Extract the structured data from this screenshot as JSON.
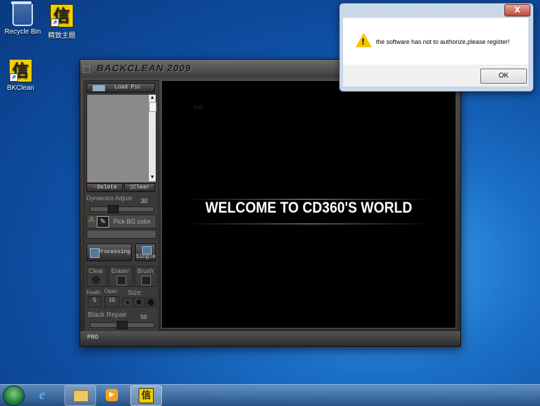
{
  "desktop": {
    "icons": [
      {
        "label": "Recycle Bin"
      },
      {
        "label": "精致主题"
      },
      {
        "label": "BKClean"
      }
    ]
  },
  "app": {
    "title": "BACKCLEAN 2009",
    "load_pic_label": "Load Pic",
    "delete_label": "Delete",
    "clear_label": "Clear",
    "dynamics_label": "Dynamics Adjust",
    "dynamics_value": "30",
    "pick_bg_label": "Pick BG color",
    "processing_label": "Processing",
    "single_label": "Single",
    "tool_clear_label": "Clear",
    "tool_eraser_label": "Eraser",
    "tool_brush_label": "Brush",
    "feath_label": "Feath",
    "feath_value": "5",
    "opac_label": "Opac",
    "opac_value": "10",
    "size_label": "Size",
    "black_repair_label": "Black Repair",
    "black_repair_value": "50",
    "canvas_mark": "CH3",
    "welcome_text": "WELCOME TO CD360'S WORLD",
    "status_text": "PRO"
  },
  "dialog": {
    "close_glyph": "X",
    "message": "the software has not to authorize,please register!",
    "ok_label": "OK"
  },
  "colors": {
    "dialog_close": "#c2483a",
    "desktop_blue": "#1b6fc7",
    "warning": "#f5c400"
  }
}
